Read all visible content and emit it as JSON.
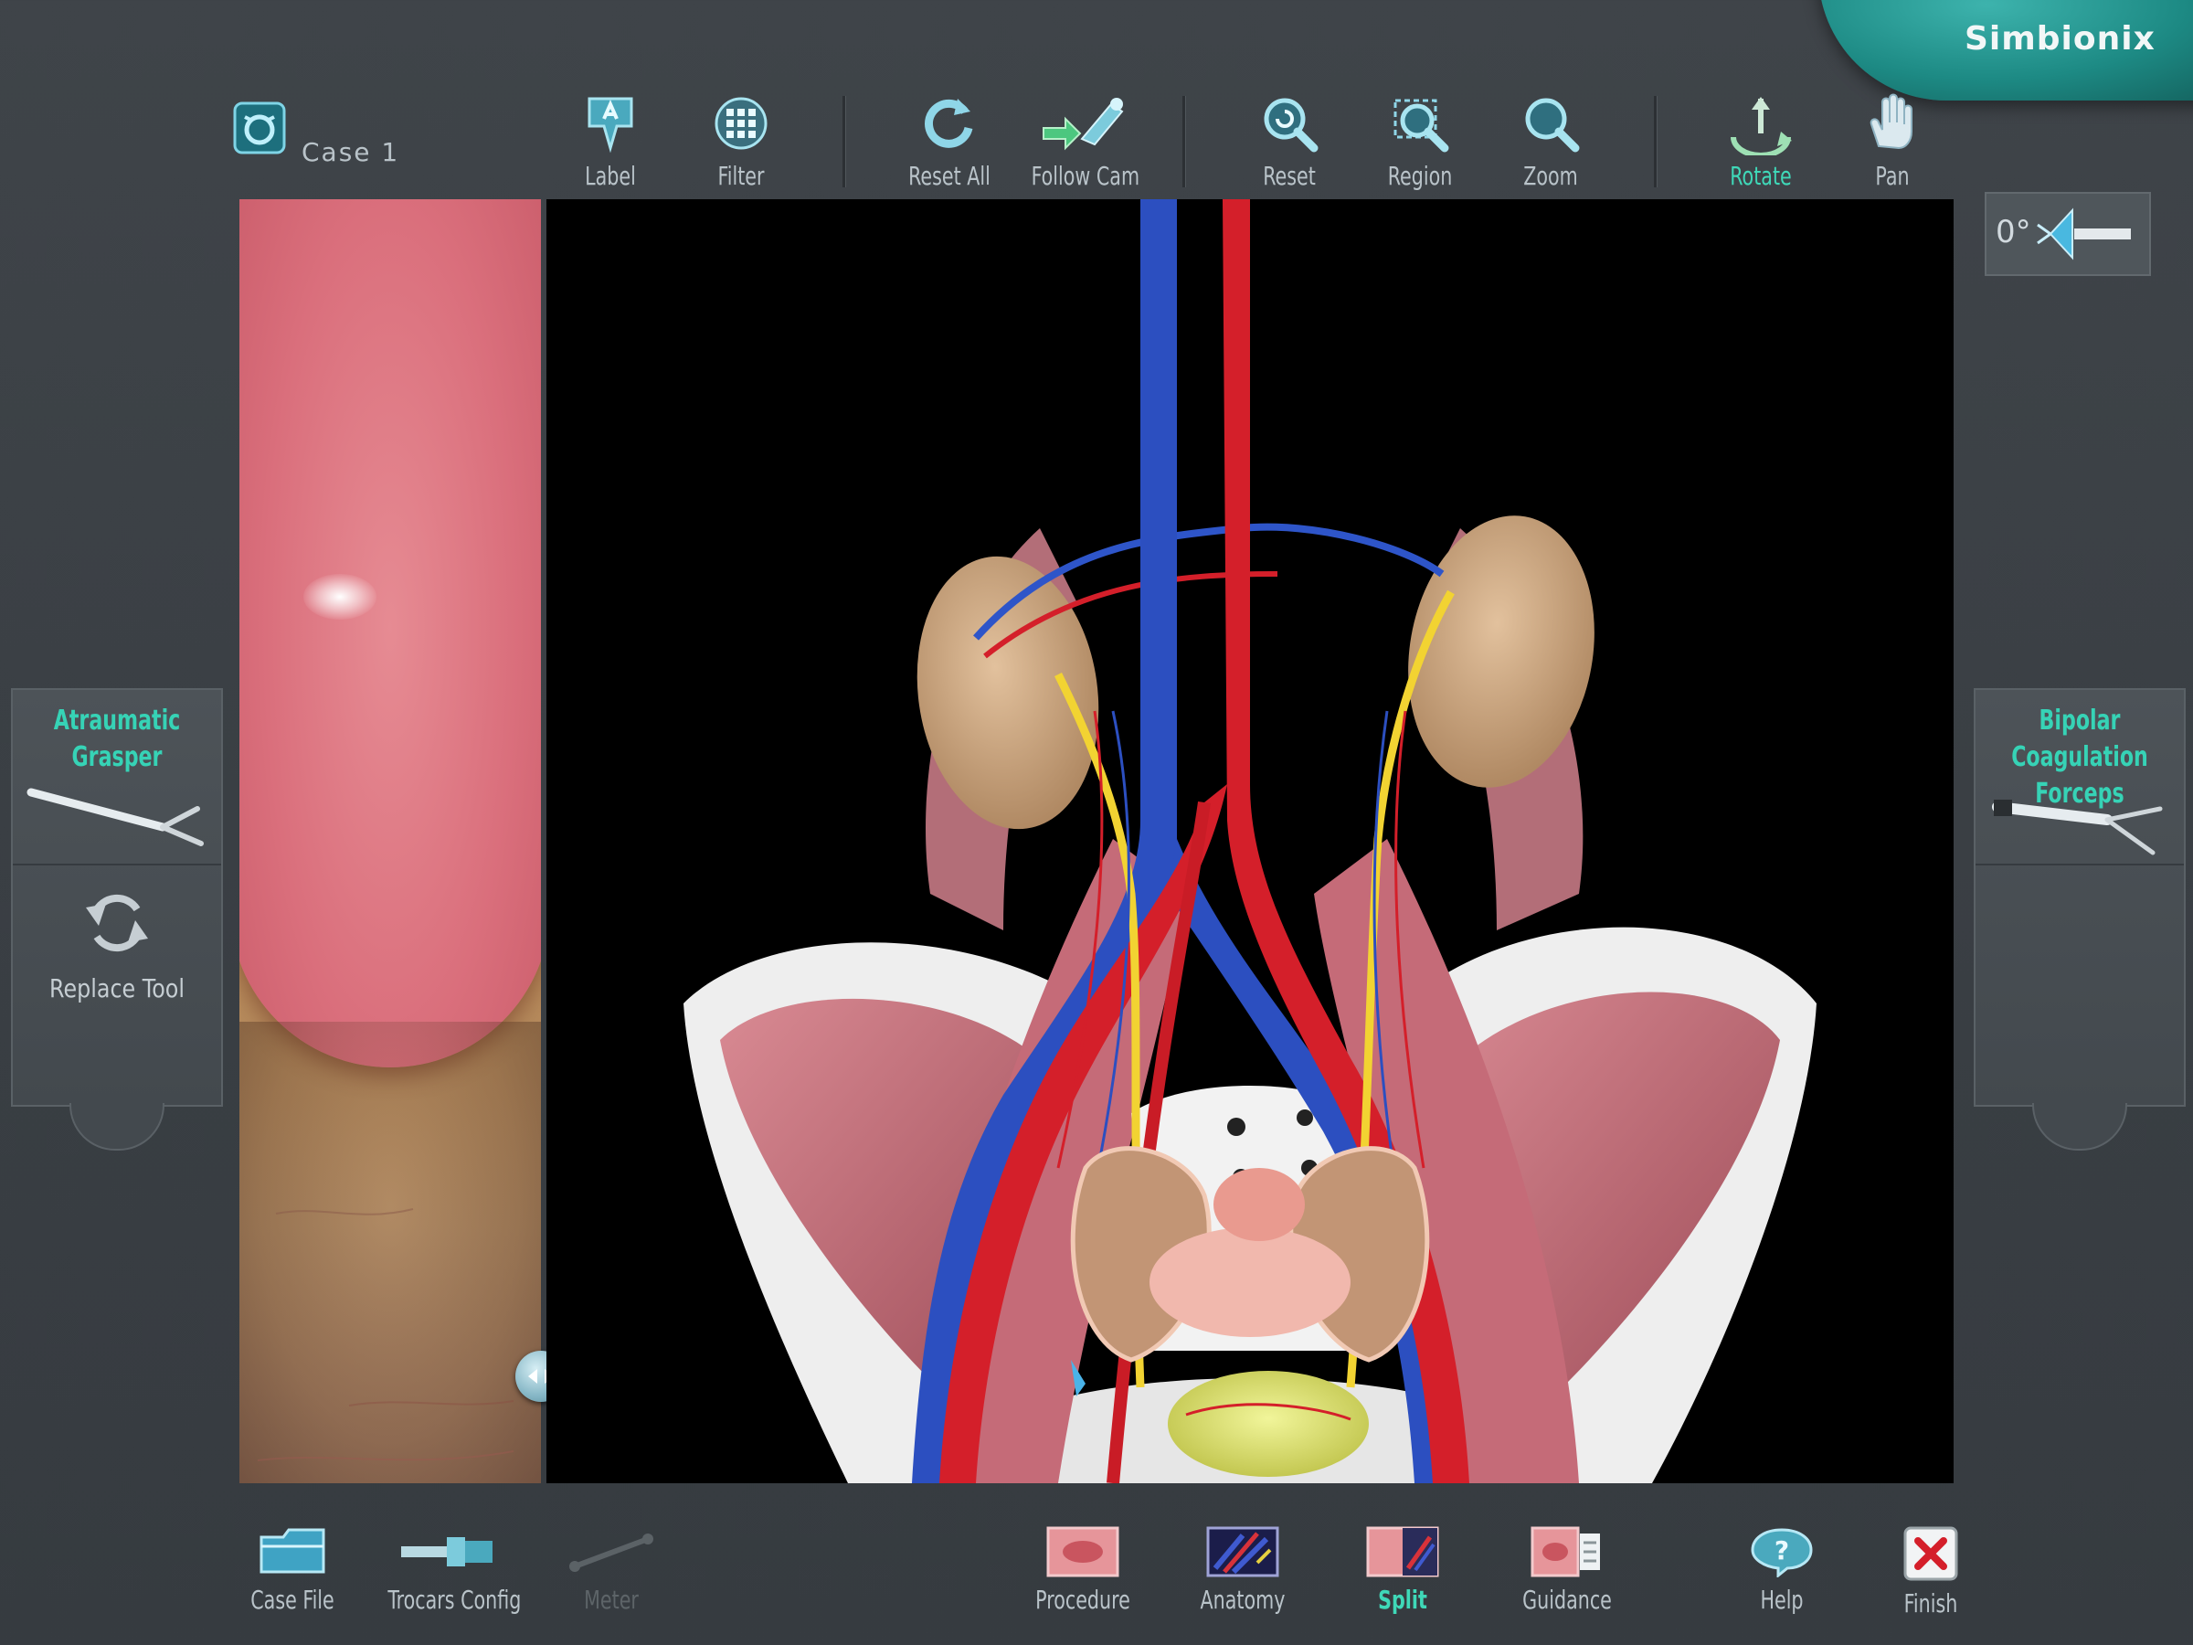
{
  "brand": {
    "name": "Simbionix"
  },
  "case": {
    "title": "Case 1"
  },
  "toolbar": {
    "label": "Label",
    "filter": "Filter",
    "reset_all": "Reset All",
    "follow_cam": "Follow Cam",
    "reset": "Reset",
    "region": "Region",
    "zoom": "Zoom",
    "rotate": "Rotate",
    "pan": "Pan"
  },
  "left_tool": {
    "title_line1": "Atraumatic",
    "title_line2": "Grasper",
    "replace_label": "Replace Tool"
  },
  "right_tool": {
    "title_line1": "Bipolar Coagulation",
    "title_line2": "Forceps"
  },
  "camera": {
    "angle": "0°"
  },
  "bottom_bar": {
    "case_file": "Case File",
    "trocars_config": "Trocars Config",
    "meter": "Meter",
    "procedure": "Procedure",
    "anatomy": "Anatomy",
    "split": "Split",
    "guidance": "Guidance",
    "help": "Help",
    "finish": "Finish"
  },
  "colors": {
    "accent": "#36d3b6",
    "active_label": "#3fd8b8",
    "brand": "#1d8a84"
  }
}
